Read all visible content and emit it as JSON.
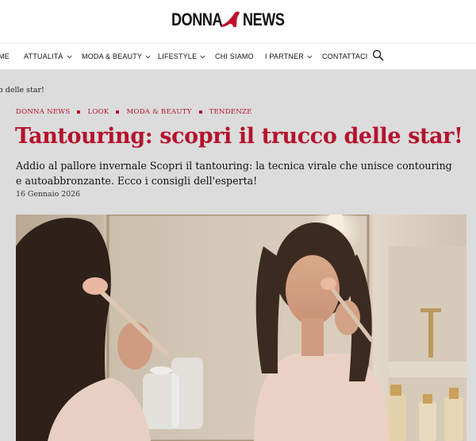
{
  "site": {
    "logo_part1": "DONNA",
    "logo_part2": "NEWS",
    "brand_color": "#c0102a"
  },
  "nav": {
    "items": [
      {
        "label": "ME",
        "has_dropdown": false
      },
      {
        "label": "ATTUALITÀ",
        "has_dropdown": true
      },
      {
        "label": "MODA & BEAUTY",
        "has_dropdown": true
      },
      {
        "label": "LIFESTYLE",
        "has_dropdown": true
      },
      {
        "label": "CHI SIAMO",
        "has_dropdown": false
      },
      {
        "label": "I PARTNER",
        "has_dropdown": true
      },
      {
        "label": "CONTATTACI",
        "has_dropdown": false
      }
    ],
    "search_icon": "search-icon"
  },
  "breadcrumb": {
    "text": "o delle star!"
  },
  "article": {
    "categories": [
      "DONNA NEWS",
      "LOOK",
      "MODA & BEAUTY",
      "TENDENZE"
    ],
    "title": "Tantouring: scopri il trucco delle star!",
    "subtitle": "Addio al pallore invernale Scopri il tantouring: la tecnica virale che unisce contouring e autoabbronzante. Ecco i consigli dell'esperta!",
    "date": "16 Gennaio 2026",
    "accent_color": "#b5122c"
  }
}
